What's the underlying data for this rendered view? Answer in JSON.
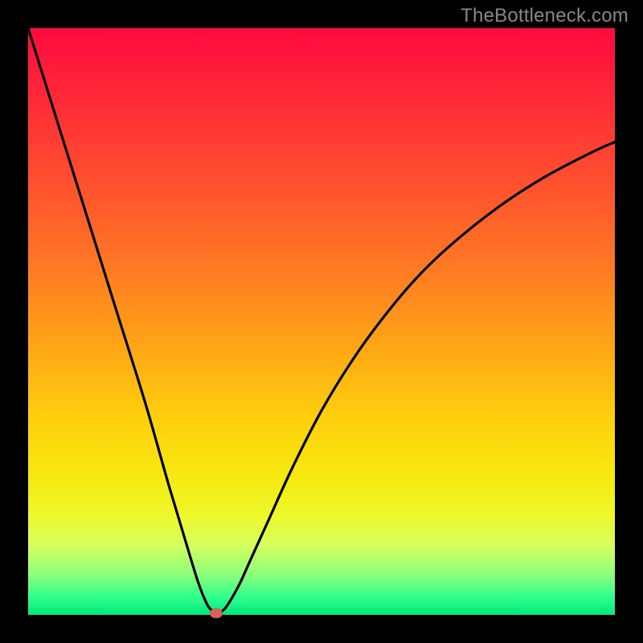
{
  "watermark": "TheBottleneck.com",
  "chart_data": {
    "type": "line",
    "title": "",
    "xlabel": "",
    "ylabel": "",
    "xlim": [
      0,
      100
    ],
    "ylim": [
      0,
      100
    ],
    "grid": false,
    "background_gradient": [
      "#ff0a3f",
      "#ff7d22",
      "#ffce0e",
      "#eef82a",
      "#2fff8d"
    ],
    "series": [
      {
        "name": "bottleneck-curve",
        "color": "#000000",
        "x": [
          0,
          5,
          10,
          15,
          20,
          24,
          27,
          29,
          30.5,
          31.5,
          32,
          33,
          34,
          36,
          38,
          41,
          45,
          50,
          55,
          60,
          66,
          72,
          80,
          88,
          96,
          100
        ],
        "y": [
          100,
          84,
          68,
          52,
          36,
          22,
          12,
          5.5,
          1.8,
          0.6,
          0.3,
          0.6,
          1.7,
          5.2,
          9.6,
          16.2,
          25,
          34.8,
          43,
          50,
          57.2,
          63,
          69.4,
          74.6,
          78.8,
          80.6
        ]
      }
    ],
    "marker": {
      "name": "optimal-point",
      "x": 32,
      "y": 0.3,
      "color": "#d9635a"
    }
  }
}
